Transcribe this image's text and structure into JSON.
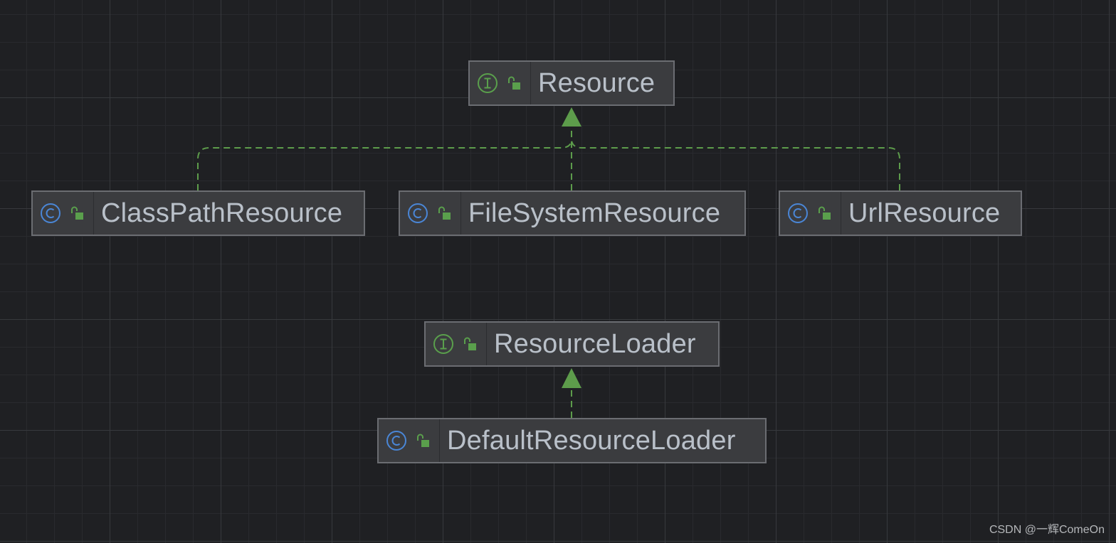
{
  "diagram": {
    "nodes": [
      {
        "id": "resource",
        "kind": "interface",
        "label": "Resource",
        "kind_icon": "interface-icon",
        "access_icon": "public-lock-icon"
      },
      {
        "id": "classpath",
        "kind": "class",
        "label": "ClassPathResource",
        "kind_icon": "class-icon",
        "access_icon": "public-lock-icon"
      },
      {
        "id": "filesystem",
        "kind": "class",
        "label": "FileSystemResource",
        "kind_icon": "class-icon",
        "access_icon": "public-lock-icon"
      },
      {
        "id": "url",
        "kind": "class",
        "label": "UrlResource",
        "kind_icon": "class-icon",
        "access_icon": "public-lock-icon"
      },
      {
        "id": "loader",
        "kind": "interface",
        "label": "ResourceLoader",
        "kind_icon": "interface-icon",
        "access_icon": "public-lock-icon"
      },
      {
        "id": "defaultloader",
        "kind": "class",
        "label": "DefaultResourceLoader",
        "kind_icon": "class-icon",
        "access_icon": "public-lock-icon"
      }
    ],
    "edges": [
      {
        "from": "classpath",
        "to": "resource",
        "type": "implements"
      },
      {
        "from": "filesystem",
        "to": "resource",
        "type": "implements"
      },
      {
        "from": "url",
        "to": "resource",
        "type": "implements"
      },
      {
        "from": "defaultloader",
        "to": "loader",
        "type": "implements"
      }
    ]
  },
  "colors": {
    "background": "#1f2023",
    "edge": "#5d9c4b",
    "interface_icon": "#5a9f4c",
    "class_icon": "#4a86d6",
    "lock_icon": "#5a9f4c",
    "label": "#b9c0c9"
  },
  "watermark": "CSDN @一辉ComeOn"
}
